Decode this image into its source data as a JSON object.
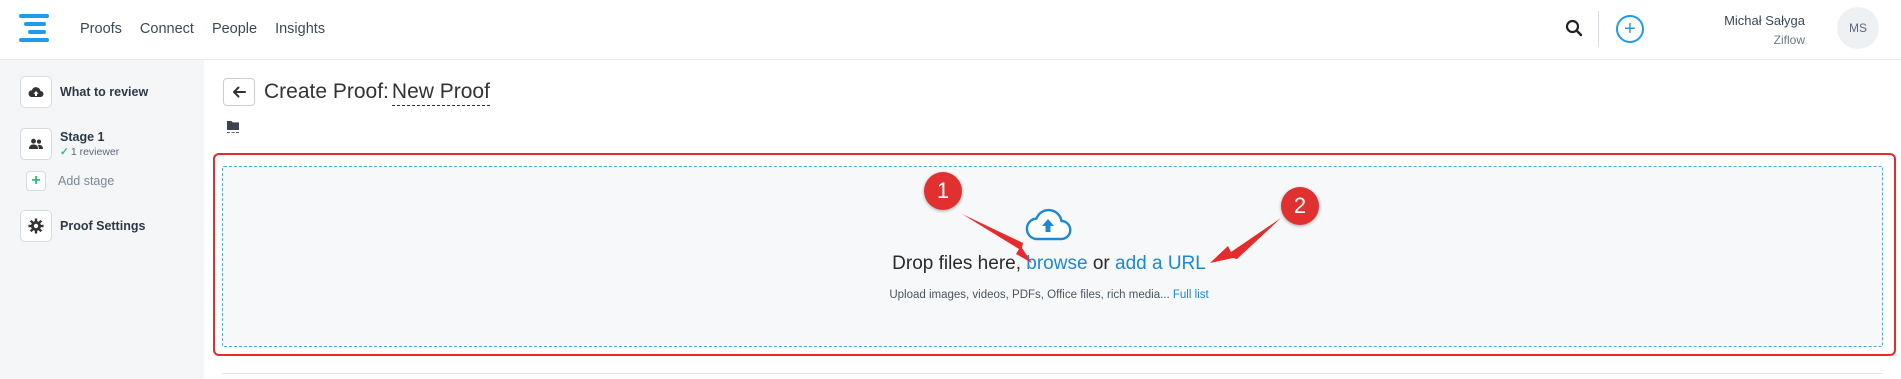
{
  "topbar": {
    "nav": [
      "Proofs",
      "Connect",
      "People",
      "Insights"
    ],
    "user_name": "Michał Sałyga",
    "user_org": "Ziflow",
    "avatar_initials": "MS",
    "icons": {
      "search": "search-icon",
      "add": "plus-circle-icon",
      "logo": "ziflow-logo"
    }
  },
  "sidebar": {
    "what_to_review": "What to review",
    "stage_label": "Stage 1",
    "stage_sub": "1 reviewer",
    "add_stage": "Add stage",
    "proof_settings": "Proof Settings"
  },
  "main": {
    "title_prefix": "Create Proof:",
    "proof_name": "New Proof",
    "drop": {
      "lead": "Drop files here,",
      "browse": "browse",
      "or": "or",
      "add_url": "add a URL",
      "sub": "Upload images, videos, PDFs, Office files, rich media...",
      "full_list": "Full list"
    }
  },
  "annotations": {
    "marker1": "1",
    "marker2": "2"
  },
  "colors": {
    "accent": "#1e9be9",
    "link": "#1e87d6",
    "annotation": "#e52b2b",
    "check": "#2fbf71"
  }
}
